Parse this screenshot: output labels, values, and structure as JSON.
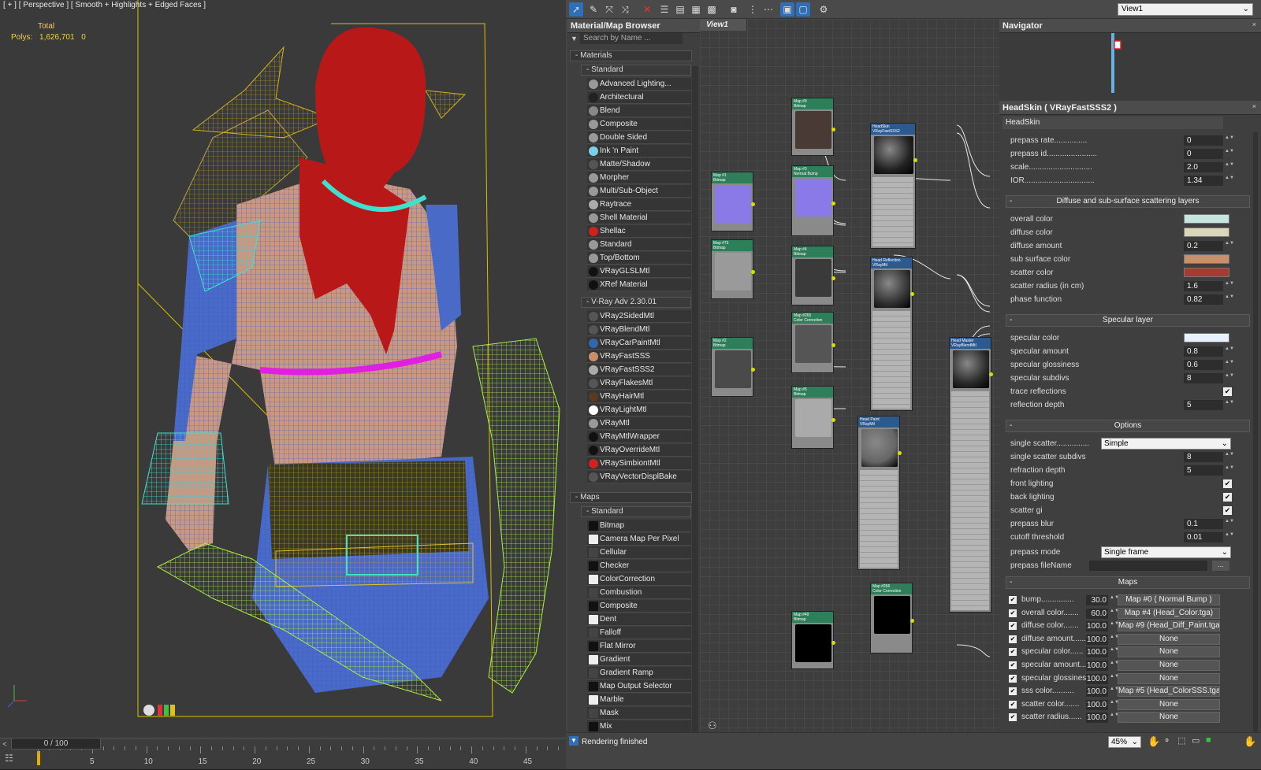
{
  "viewport": {
    "label": "[ + ] [ Perspective ] [ Smooth + Highlights + Edged Faces ]",
    "stats_total": "Total",
    "stats_polys_label": "Polys:",
    "stats_polys_value": "1,626,701",
    "stats_polys_sel": "0"
  },
  "timeline": {
    "frame": "0 / 100",
    "ticks": [
      "5",
      "10",
      "15",
      "20",
      "25",
      "30",
      "35",
      "40",
      "45"
    ]
  },
  "toolbar": {
    "view_select": "View1"
  },
  "browser": {
    "title": "Material/Map Browser",
    "search_placeholder": "Search by Name ...",
    "materials_header": "Materials",
    "standard_header": "Standard",
    "standard_items": [
      "Advanced Lighting...",
      "Architectural",
      "Blend",
      "Composite",
      "Double Sided",
      "Ink 'n Paint",
      "Matte/Shadow",
      "Morpher",
      "Multi/Sub-Object",
      "Raytrace",
      "Shell Material",
      "Shellac",
      "Standard",
      "Top/Bottom",
      "VRayGLSLMtl",
      "XRef Material"
    ],
    "vray_header": "V-Ray Adv 2.30.01",
    "vray_items": [
      "VRay2SidedMtl",
      "VRayBlendMtl",
      "VRayCarPaintMtl",
      "VRayFastSSS",
      "VRayFastSSS2",
      "VRayFlakesMtl",
      "VRayHairMtl",
      "VRayLightMtl",
      "VRayMtl",
      "VRayMtlWrapper",
      "VRayOverrideMtl",
      "VRaySimbiontMtl",
      "VRayVectorDisplBake"
    ],
    "maps_header": "Maps",
    "maps_standard_header": "Standard",
    "map_items": [
      "Bitmap",
      "Camera Map Per Pixel",
      "Cellular",
      "Checker",
      "ColorCorrection",
      "Combustion",
      "Composite",
      "Dent",
      "Falloff",
      "Flat Mirror",
      "Gradient",
      "Gradient Ramp",
      "Map Output Selector",
      "Marble",
      "Mask",
      "Mix"
    ]
  },
  "graph": {
    "tab": "View1",
    "nodes": [
      {
        "title": "Map #1\nBitmap"
      },
      {
        "title": "Map #73\nBitmap"
      },
      {
        "title": "Map #2\nBitmap"
      },
      {
        "title": "Map #5\nBitmap"
      },
      {
        "title": "Map #3\nNormal Bump"
      },
      {
        "title": "Map #4\nBitmap"
      },
      {
        "title": "Map #265\nColor Correction"
      },
      {
        "title": "Map #9\nBitmap"
      },
      {
        "title": "Map #49\nBitmap"
      },
      {
        "title": "HeadSkin\nVRayFastSSS2"
      },
      {
        "title": "Head Reflection\nVRayMtl"
      },
      {
        "title": "Head Paint\nVRayMtl"
      },
      {
        "title": "Map #266\nColor Correction"
      },
      {
        "title": "Head Master\nVRayBlendMtl"
      }
    ]
  },
  "navigator": {
    "title": "Navigator"
  },
  "params": {
    "title": "HeadSkin  ( VRayFastSSS2 )",
    "name": "HeadSkin",
    "rows1": [
      {
        "label": "prepass rate...............",
        "value": "0"
      },
      {
        "label": "prepass id.......................",
        "value": "0"
      },
      {
        "label": "scale.............................",
        "value": "2.0"
      },
      {
        "label": "IOR................................",
        "value": "1.34"
      }
    ],
    "sect_diffuse": "Diffuse and sub-surface scattering layers",
    "diffuse_rows": [
      {
        "label": "overall color",
        "color": "#c8e4e0"
      },
      {
        "label": "diffuse color",
        "color": "#d8d8b8"
      },
      {
        "label": "diffuse amount",
        "value": "0.2"
      },
      {
        "label": "sub surface color",
        "color": "#c8906a"
      },
      {
        "label": "scatter color",
        "color": "#a83a30"
      },
      {
        "label": "scatter radius (in cm)",
        "value": "1.6"
      },
      {
        "label": "phase function",
        "value": "0.82"
      }
    ],
    "sect_specular": "Specular layer",
    "specular_rows": [
      {
        "label": "specular color",
        "color": "#e8f2ff"
      },
      {
        "label": "specular amount",
        "value": "0.8"
      },
      {
        "label": "specular glossiness",
        "value": "0.6"
      },
      {
        "label": "specular subdivs",
        "value": "8"
      },
      {
        "label": "trace reflections",
        "check": "✔"
      },
      {
        "label": "reflection depth",
        "value": "5"
      }
    ],
    "sect_options": "Options",
    "single_scatter_label": "single scatter...............",
    "single_scatter_value": "Simple",
    "options_rows": [
      {
        "label": "single scatter subdivs",
        "value": "8"
      },
      {
        "label": "refraction depth",
        "value": "5"
      },
      {
        "label": "front lighting",
        "check": "✔"
      },
      {
        "label": "back lighting",
        "check": "✔"
      },
      {
        "label": "scatter gi",
        "check": "✔"
      },
      {
        "label": "prepass blur",
        "value": "0.1"
      },
      {
        "label": "cutoff threshold",
        "value": "0.01"
      }
    ],
    "prepass_mode_label": "prepass mode",
    "prepass_mode_value": "Single frame",
    "prepass_file_label": "prepass fileName",
    "sect_maps": "Maps",
    "map_rows": [
      {
        "label": "bump...............",
        "value": "30.0",
        "map": "Map #0  ( Normal Bump )"
      },
      {
        "label": "overall color.......",
        "value": "60.0",
        "map": "Map #4 (Head_Color.tga)"
      },
      {
        "label": "diffuse color.......",
        "value": "100.0",
        "map": "Map #9 (Head_Diff_Paint.tga)"
      },
      {
        "label": "diffuse amount......",
        "value": "100.0",
        "map": "None"
      },
      {
        "label": "specular color......",
        "value": "100.0",
        "map": "None"
      },
      {
        "label": "specular amount...",
        "value": "100.0",
        "map": "None"
      },
      {
        "label": "specular glossiness",
        "value": "100.0",
        "map": "None"
      },
      {
        "label": "sss color..........",
        "value": "100.0",
        "map": "Map #5 (Head_ColorSSS.tga)"
      },
      {
        "label": "scatter color.......",
        "value": "100.0",
        "map": "None"
      },
      {
        "label": "scatter radius......",
        "value": "100.0",
        "map": "None"
      }
    ]
  },
  "status": {
    "text": "Rendering finished",
    "zoom": "45%"
  },
  "colors": {
    "accent": "#2f6fb5",
    "node_header": "#2e7e5a",
    "socket": "#d8e000",
    "stats": "#f0d050"
  }
}
